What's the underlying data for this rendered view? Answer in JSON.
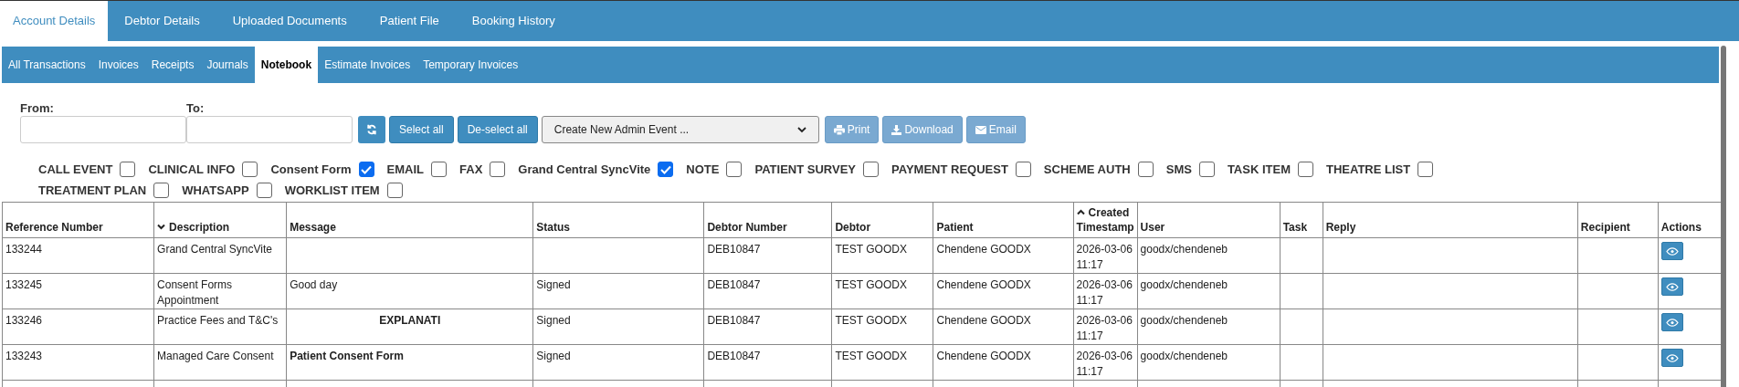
{
  "main_tabs": [
    {
      "label": "Account Details",
      "selected": true
    },
    {
      "label": "Debtor Details",
      "selected": false
    },
    {
      "label": "Uploaded Documents",
      "selected": false
    },
    {
      "label": "Patient File",
      "selected": false
    },
    {
      "label": "Booking History",
      "selected": false
    }
  ],
  "sub_tabs": [
    {
      "label": "All Transactions",
      "selected": false
    },
    {
      "label": "Invoices",
      "selected": false
    },
    {
      "label": "Receipts",
      "selected": false
    },
    {
      "label": "Journals",
      "selected": false
    },
    {
      "label": "Notebook",
      "selected": true
    },
    {
      "label": "Estimate Invoices",
      "selected": false
    },
    {
      "label": "Temporary Invoices",
      "selected": false
    }
  ],
  "filters": {
    "from_label": "From:",
    "to_label": "To:",
    "select_all": "Select all",
    "deselect_all": "De-select all",
    "admin_event": "Create New Admin Event ...",
    "actions": [
      {
        "kind": "print",
        "label": "Print",
        "disabled": true
      },
      {
        "kind": "download",
        "label": "Download",
        "disabled": true
      },
      {
        "kind": "email",
        "label": "Email",
        "disabled": true
      }
    ]
  },
  "event_types": [
    {
      "label": "CALL EVENT",
      "checked": false
    },
    {
      "label": "CLINICAL INFO",
      "checked": false
    },
    {
      "label": "Consent Form",
      "checked": true
    },
    {
      "label": "EMAIL",
      "checked": false
    },
    {
      "label": "FAX",
      "checked": false
    },
    {
      "label": "Grand Central SyncVite",
      "checked": true
    },
    {
      "label": "NOTE",
      "checked": false
    },
    {
      "label": "PATIENT SURVEY",
      "checked": false
    },
    {
      "label": "PAYMENT REQUEST",
      "checked": false
    },
    {
      "label": "SCHEME AUTH",
      "checked": false
    },
    {
      "label": "SMS",
      "checked": false
    },
    {
      "label": "TASK ITEM",
      "checked": false
    },
    {
      "label": "THEATRE LIST",
      "checked": false
    },
    {
      "label": "TREATMENT PLAN",
      "checked": false
    },
    {
      "label": "WHATSAPP",
      "checked": false
    },
    {
      "label": "WORKLIST ITEM",
      "checked": false
    }
  ],
  "table": {
    "columns": [
      {
        "label": "Reference Number",
        "sorted": false
      },
      {
        "label": "Description",
        "sorted": true,
        "descending": true
      },
      {
        "label": "Message",
        "sorted": false
      },
      {
        "label": "Status",
        "sorted": false
      },
      {
        "label": "Debtor Number",
        "sorted": false
      },
      {
        "label": "Debtor",
        "sorted": false
      },
      {
        "label": "Patient",
        "sorted": false
      },
      {
        "label": "Created Timestamp",
        "sorted": true,
        "descending": false
      },
      {
        "label": "User",
        "sorted": false
      },
      {
        "label": "Task",
        "sorted": false
      },
      {
        "label": "Reply",
        "sorted": false
      },
      {
        "label": "Recipient",
        "sorted": false
      },
      {
        "label": "Actions",
        "sorted": false
      }
    ],
    "rows": [
      {
        "cells": [
          "133244",
          "Grand Central SyncVite",
          "",
          "",
          "DEB10847",
          "TEST GOODX",
          "Chendene GOODX",
          "2026-03-06 11:17",
          "goodx/chendeneb",
          "",
          "",
          ""
        ]
      },
      {
        "cells": [
          "133245",
          "Consent Forms Appointment",
          "Good day",
          "Signed",
          "DEB10847",
          "TEST GOODX",
          "Chendene GOODX",
          "2026-03-06 11:17",
          "goodx/chendeneb",
          "",
          "",
          ""
        ],
        "message_bold": false,
        "message_centered": false
      },
      {
        "cells": [
          "133246",
          "Practice Fees and T&C's",
          "EXPLANATI",
          "Signed",
          "DEB10847",
          "TEST GOODX",
          "Chendene GOODX",
          "2026-03-06 11:17",
          "goodx/chendeneb",
          "",
          "",
          ""
        ],
        "message_bold": true,
        "message_centered": true
      },
      {
        "cells": [
          "133243",
          "Managed Care Consent",
          "Patient Consent Form",
          "Signed",
          "DEB10847",
          "TEST GOODX",
          "Chendene GOODX",
          "2026-03-06 11:17",
          "goodx/chendeneb",
          "",
          "",
          ""
        ],
        "message_bold": true,
        "message_centered": false
      }
    ]
  }
}
